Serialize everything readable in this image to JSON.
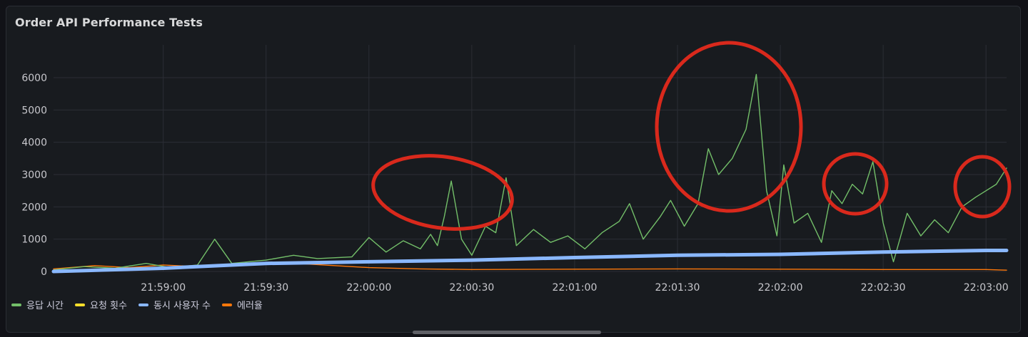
{
  "panel": {
    "title": "Order API Performance Tests"
  },
  "chart_data": {
    "type": "line",
    "title": "Order API Performance Tests",
    "ylim": [
      0,
      6000
    ],
    "y_ticks": [
      0,
      1000,
      2000,
      3000,
      4000,
      5000,
      6000
    ],
    "x_range": [
      "21:58:28",
      "22:03:06"
    ],
    "x_ticks": [
      "21:59:00",
      "21:59:30",
      "22:00:00",
      "22:00:30",
      "22:01:00",
      "22:01:30",
      "22:02:00",
      "22:02:30",
      "22:03:00"
    ],
    "grid": true,
    "legend_position": "bottom-left",
    "series": [
      {
        "name": "응답 시간",
        "color": "#73bf69",
        "points": [
          [
            "21:58:28",
            50
          ],
          [
            "21:58:37",
            150
          ],
          [
            "21:58:46",
            100
          ],
          [
            "21:58:55",
            250
          ],
          [
            "21:59:02",
            120
          ],
          [
            "21:59:10",
            200
          ],
          [
            "21:59:15",
            1000
          ],
          [
            "21:59:20",
            250
          ],
          [
            "21:59:30",
            350
          ],
          [
            "21:59:38",
            500
          ],
          [
            "21:59:45",
            400
          ],
          [
            "21:59:55",
            450
          ],
          [
            "22:00:00",
            1050
          ],
          [
            "22:00:05",
            600
          ],
          [
            "22:00:10",
            950
          ],
          [
            "22:00:15",
            700
          ],
          [
            "22:00:18",
            1150
          ],
          [
            "22:00:20",
            800
          ],
          [
            "22:00:22",
            1700
          ],
          [
            "22:00:24",
            2800
          ],
          [
            "22:00:27",
            1000
          ],
          [
            "22:00:30",
            500
          ],
          [
            "22:00:34",
            1400
          ],
          [
            "22:00:37",
            1200
          ],
          [
            "22:00:40",
            2900
          ],
          [
            "22:00:43",
            800
          ],
          [
            "22:00:48",
            1300
          ],
          [
            "22:00:53",
            900
          ],
          [
            "22:00:58",
            1100
          ],
          [
            "22:01:03",
            700
          ],
          [
            "22:01:08",
            1200
          ],
          [
            "22:01:13",
            1550
          ],
          [
            "22:01:16",
            2100
          ],
          [
            "22:01:20",
            1000
          ],
          [
            "22:01:25",
            1700
          ],
          [
            "22:01:28",
            2200
          ],
          [
            "22:01:32",
            1400
          ],
          [
            "22:01:36",
            2100
          ],
          [
            "22:01:39",
            3800
          ],
          [
            "22:01:42",
            3000
          ],
          [
            "22:01:46",
            3500
          ],
          [
            "22:01:50",
            4400
          ],
          [
            "22:01:53",
            6100
          ],
          [
            "22:01:56",
            2500
          ],
          [
            "22:01:59",
            1100
          ],
          [
            "22:02:01",
            3300
          ],
          [
            "22:02:04",
            1500
          ],
          [
            "22:02:08",
            1800
          ],
          [
            "22:02:12",
            900
          ],
          [
            "22:02:15",
            2500
          ],
          [
            "22:02:18",
            2100
          ],
          [
            "22:02:21",
            2700
          ],
          [
            "22:02:24",
            2400
          ],
          [
            "22:02:27",
            3400
          ],
          [
            "22:02:30",
            1500
          ],
          [
            "22:02:33",
            300
          ],
          [
            "22:02:37",
            1800
          ],
          [
            "22:02:41",
            1100
          ],
          [
            "22:02:45",
            1600
          ],
          [
            "22:02:49",
            1200
          ],
          [
            "22:02:53",
            2000
          ],
          [
            "22:02:57",
            2300
          ],
          [
            "22:03:00",
            2500
          ],
          [
            "22:03:03",
            2700
          ],
          [
            "22:03:06",
            3200
          ]
        ]
      },
      {
        "name": "요청 횟수",
        "color": "#fade2a",
        "points": []
      },
      {
        "name": "동시 사용자 수",
        "color": "#8ab8ff",
        "points": [
          [
            "21:58:28",
            0
          ],
          [
            "21:59:00",
            100
          ],
          [
            "21:59:30",
            250
          ],
          [
            "22:00:00",
            300
          ],
          [
            "22:00:30",
            350
          ],
          [
            "22:01:00",
            430
          ],
          [
            "22:01:30",
            500
          ],
          [
            "22:02:00",
            530
          ],
          [
            "22:02:30",
            600
          ],
          [
            "22:03:00",
            650
          ],
          [
            "22:03:06",
            650
          ]
        ]
      },
      {
        "name": "에러율",
        "color": "#ff780a",
        "points": [
          [
            "21:58:28",
            80
          ],
          [
            "21:58:40",
            180
          ],
          [
            "21:58:50",
            120
          ],
          [
            "21:59:00",
            200
          ],
          [
            "21:59:10",
            150
          ],
          [
            "21:59:20",
            220
          ],
          [
            "21:59:30",
            260
          ],
          [
            "21:59:40",
            240
          ],
          [
            "21:59:50",
            180
          ],
          [
            "22:00:00",
            120
          ],
          [
            "22:00:15",
            80
          ],
          [
            "22:00:30",
            60
          ],
          [
            "22:01:00",
            70
          ],
          [
            "22:01:30",
            80
          ],
          [
            "22:02:00",
            70
          ],
          [
            "22:02:30",
            60
          ],
          [
            "22:03:00",
            60
          ],
          [
            "22:03:06",
            40
          ]
        ]
      }
    ]
  },
  "legend": [
    {
      "label": "응답 시간",
      "color": "#73bf69"
    },
    {
      "label": "요청 횟수",
      "color": "#fade2a"
    },
    {
      "label": "동시 사용자 수",
      "color": "#8ab8ff"
    },
    {
      "label": "에러율",
      "color": "#ff780a"
    }
  ],
  "annotation_color": "#d9291c"
}
